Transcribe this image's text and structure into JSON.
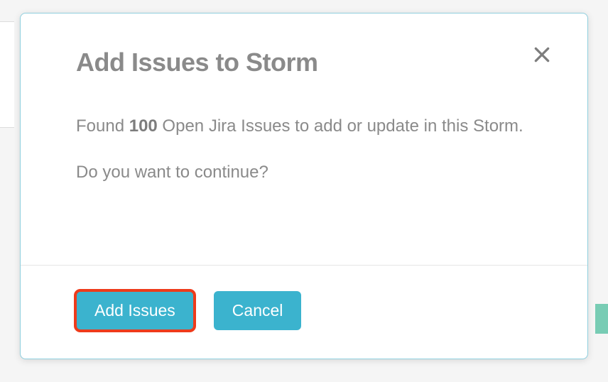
{
  "modal": {
    "title": "Add Issues to Storm",
    "message_prefix": "Found ",
    "message_count": "100",
    "message_suffix": " Open Jira Issues to add or update in this Storm.",
    "confirm_text": "Do you want to continue?",
    "add_label": "Add Issues",
    "cancel_label": "Cancel"
  }
}
